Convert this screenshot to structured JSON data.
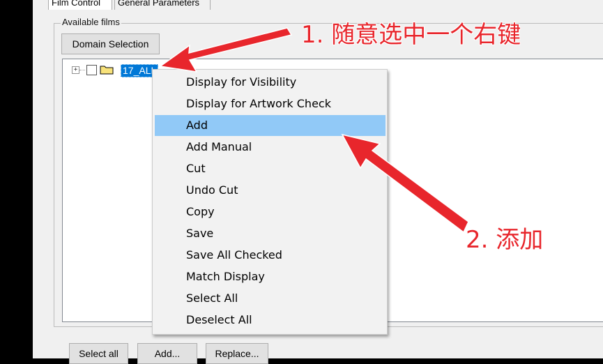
{
  "tabs": [
    {
      "label": "Film Control"
    },
    {
      "label": "General Parameters"
    }
  ],
  "group_label": "Available films",
  "domain_button": "Domain Selection",
  "tree": {
    "expander": "+",
    "item_label": "17_ALL",
    "checked": false,
    "selection_color": "#0078d7"
  },
  "context_menu": {
    "items": [
      {
        "label": "Display for Visibility"
      },
      {
        "label": "Display for Artwork Check"
      },
      {
        "label": "Add",
        "highlighted": true
      },
      {
        "label": "Add Manual"
      },
      {
        "label": "Cut"
      },
      {
        "label": "Undo Cut"
      },
      {
        "label": "Copy"
      },
      {
        "label": "Save"
      },
      {
        "label": "Save All Checked"
      },
      {
        "label": "Match Display"
      },
      {
        "label": "Select All"
      },
      {
        "label": "Deselect All"
      }
    ],
    "highlight_color": "#91c9f7"
  },
  "bottom_buttons": {
    "select_all": "Select all",
    "add": "Add...",
    "replace": "Replace..."
  },
  "annotations": {
    "note_1": "1. 随意选中一个右键",
    "note_2": "2. 添加",
    "color": "#e8262c"
  }
}
